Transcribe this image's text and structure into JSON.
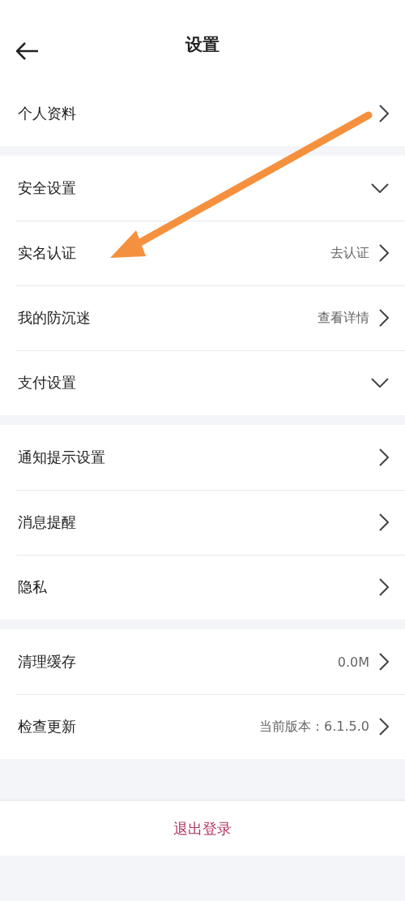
{
  "header": {
    "title": "设置"
  },
  "sections": [
    {
      "rows": [
        {
          "label": "个人资料",
          "kind": "link"
        }
      ]
    },
    {
      "rows": [
        {
          "label": "安全设置",
          "kind": "expandable",
          "expanded": false
        },
        {
          "label": "实名认证",
          "kind": "link",
          "value": "去认证"
        },
        {
          "label": "我的防沉迷",
          "kind": "link",
          "value": "查看详情"
        },
        {
          "label": "支付设置",
          "kind": "expandable",
          "expanded": false
        }
      ]
    },
    {
      "rows": [
        {
          "label": "通知提示设置",
          "kind": "link"
        },
        {
          "label": "消息提醒",
          "kind": "link"
        },
        {
          "label": "隐私",
          "kind": "link"
        }
      ]
    },
    {
      "rows": [
        {
          "label": "清理缓存",
          "kind": "link",
          "value": "0.0M"
        },
        {
          "label": "检查更新",
          "kind": "link",
          "value": "当前版本：6.1.5.0"
        }
      ]
    }
  ],
  "logout_button": "退出登录"
}
